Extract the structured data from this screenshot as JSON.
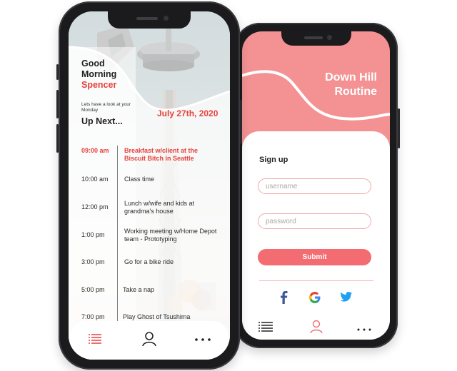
{
  "schedule_screen": {
    "greeting_line1": "Good",
    "greeting_line2": "Morning",
    "user_name": "Spencer",
    "subtitle": "Lets have a look at your Monday",
    "up_next_label": "Up Next...",
    "date": "July 27th, 2020",
    "events": [
      {
        "time": "09:00 am",
        "title": "Breakfast w/client at the Biscuit Bitch in Seattle",
        "active": true
      },
      {
        "time": "10:00 am",
        "title": "Class time",
        "active": false
      },
      {
        "time": "12:00 pm",
        "title": "Lunch w/wife and kids at grandma's house",
        "active": false
      },
      {
        "time": "1:00 pm",
        "title": "Working meeting w/Home Depot team - Prototyping",
        "active": false
      },
      {
        "time": "3:00 pm",
        "title": "Go for a bike ride",
        "active": false
      },
      {
        "time": "5:00 pm",
        "title": "Take a nap",
        "active": false
      },
      {
        "time": "7:00 pm",
        "title": "Play Ghost of Tsushima",
        "active": false
      }
    ],
    "nav_icons": [
      "list-icon",
      "user-icon",
      "more-icon"
    ]
  },
  "signup_screen": {
    "app_title_line1": "Down Hill",
    "app_title_line2": "Routine",
    "signup_title": "Sign up",
    "username_placeholder": "username",
    "password_placeholder": "password",
    "submit_label": "Submit",
    "social_icons": [
      "facebook-icon",
      "google-icon",
      "twitter-icon"
    ],
    "nav_icons": [
      "list-icon",
      "user-icon",
      "more-icon"
    ]
  },
  "colors": {
    "accent_red": "#e8403a",
    "pink_header": "#f39193",
    "submit_button": "#f36c72",
    "facebook_blue": "#3b5998",
    "twitter_blue": "#1da1f2"
  }
}
